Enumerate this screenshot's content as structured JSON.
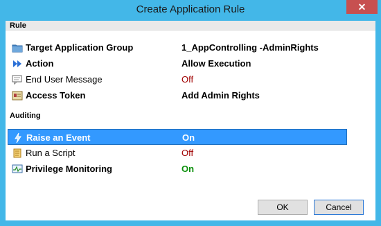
{
  "window": {
    "title": "Create Application Rule",
    "close_glyph": "✕"
  },
  "sections": {
    "rule": "Rule",
    "auditing": "Auditing"
  },
  "rule_rows": [
    {
      "label": "Target Application Group",
      "value": "1_AppControlling -AdminRights",
      "icon": "folder-icon"
    },
    {
      "label": "Action",
      "value": "Allow Execution",
      "icon": "fast-forward-icon"
    },
    {
      "label": "End User Message",
      "value": "Off",
      "icon": "message-icon"
    },
    {
      "label": "Access Token",
      "value": "Add Admin Rights",
      "icon": "token-icon"
    }
  ],
  "auditing_rows": [
    {
      "label": "Raise an Event",
      "value": "On",
      "icon": "event-icon",
      "selected": true
    },
    {
      "label": "Run a Script",
      "value": "Off",
      "icon": "script-icon"
    },
    {
      "label": "Privilege Monitoring",
      "value": "On",
      "icon": "monitor-icon"
    }
  ],
  "buttons": {
    "ok": "OK",
    "cancel": "Cancel"
  },
  "colors": {
    "frame": "#43b7e8",
    "selection": "#3399ff",
    "off": "#a00000",
    "on": "#0a8f0a"
  }
}
